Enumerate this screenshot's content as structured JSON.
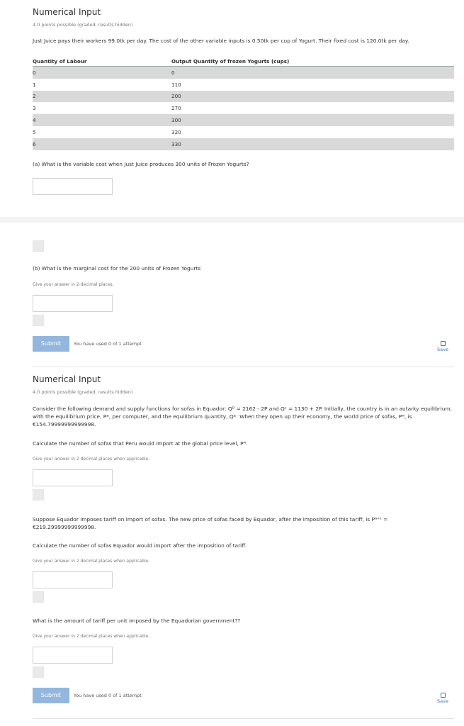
{
  "problem1": {
    "title": "Numerical Input",
    "meta": "4.0 points possible (graded, results hidden)",
    "intro": "Just Juice pays their workers 99.0tk per day. The cost of the other variable inputs is 0.50tk per cup of Yogurt. Their fixed cost is 120.0tk per day.",
    "table": {
      "headers": [
        "Quantity of Labour",
        "Output Quantity of frozen Yogurts (cups)"
      ],
      "rows": [
        [
          "0",
          "0"
        ],
        [
          "1",
          "110"
        ],
        [
          "2",
          "200"
        ],
        [
          "3",
          "270"
        ],
        [
          "4",
          "300"
        ],
        [
          "5",
          "320"
        ],
        [
          "6",
          "330"
        ]
      ]
    },
    "question_a": "(a) What is the variable cost when Just Juice produces 300 units of Frozen Yogurts?",
    "question_b": "(b) What is the marginal cost for the 200 units of Frozen Yogurts",
    "hint_b": "Give your answer in 2-decimal places.",
    "submit_label": "Submit",
    "attempts": "You have used 0 of 1 attempt",
    "save_label": "Save"
  },
  "problem2": {
    "title": "Numerical Input",
    "meta": "4.0 points possible (graded, results hidden)",
    "intro": "Consider the following demand and supply functions for sofas in Equador: Qᴰ = 2162 - 2P and Qˢ = 1130 + 2P. Initially, the country is in an autarky equilibrium, with the equilibrium price, P*, per computer, and the equilibrium quantity, Q*. When they open up their economy, the world price of sofas, Pʷ, is €154.79999999999998.",
    "question1": "Calculate the number of sofas that Peru would import at the global price level, Pʷ.",
    "hint1": "Give your answer in 2 decimal places when applicable.",
    "tariff_text": "Suppose Equador imposes tariff on import of sofas. The new price of sofas faced by Equador, after the imposition of this tariff, is Pʷ⁺ᵗ = €219.29999999999998.",
    "question2": "Calculate the number of sofas Equador would import after the imposition of tariff.",
    "hint2": "Give your answer in 2 decimal places when applicable.",
    "question3": "What is the amount of tariff per unit imposed by the Equadorian government??",
    "hint3": "Give your answer in 2 decimal places when applicable.",
    "submit_label": "Submit",
    "attempts": "You have used 0 of 1 attempt",
    "save_label": "Save"
  },
  "colors": {
    "submit_bg": "#92b6dd",
    "link": "#3c72b5",
    "row_shade": "#d9d9d9"
  },
  "icons": {
    "save": "save-icon"
  }
}
